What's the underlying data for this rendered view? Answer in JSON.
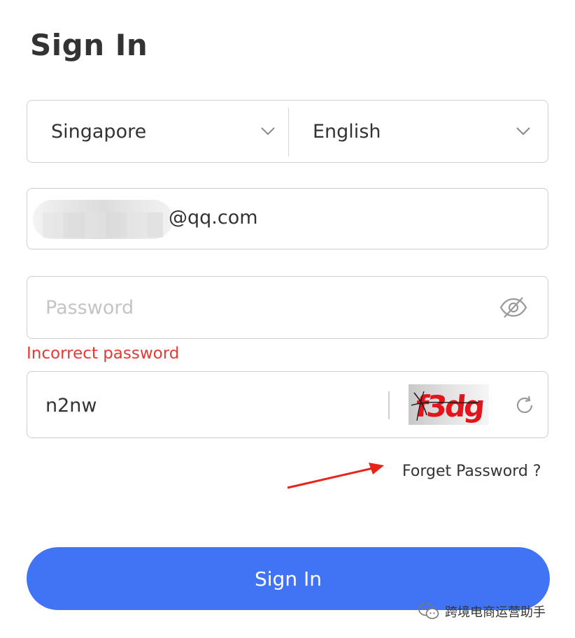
{
  "page": {
    "title": "Sign In"
  },
  "region_select": {
    "value": "Singapore"
  },
  "language_select": {
    "value": "English"
  },
  "email": {
    "visible_suffix": "@qq.com"
  },
  "password": {
    "placeholder": "Password",
    "value": "",
    "error": "Incorrect password"
  },
  "captcha": {
    "value": "n2nw",
    "image_text": "f3dg"
  },
  "links": {
    "forget_password": "Forget Password ?"
  },
  "actions": {
    "sign_in_label": "Sign In"
  },
  "watermark": {
    "text": "跨境电商运营助手"
  },
  "colors": {
    "primary": "#4174f5",
    "error": "#e53935",
    "annotation_arrow": "#e8231a",
    "captcha_text": "#e3141c"
  },
  "icons": {
    "chevron": "chevron-down-icon",
    "eye": "eye-slash-icon",
    "refresh": "refresh-icon",
    "wechat": "wechat-icon"
  }
}
